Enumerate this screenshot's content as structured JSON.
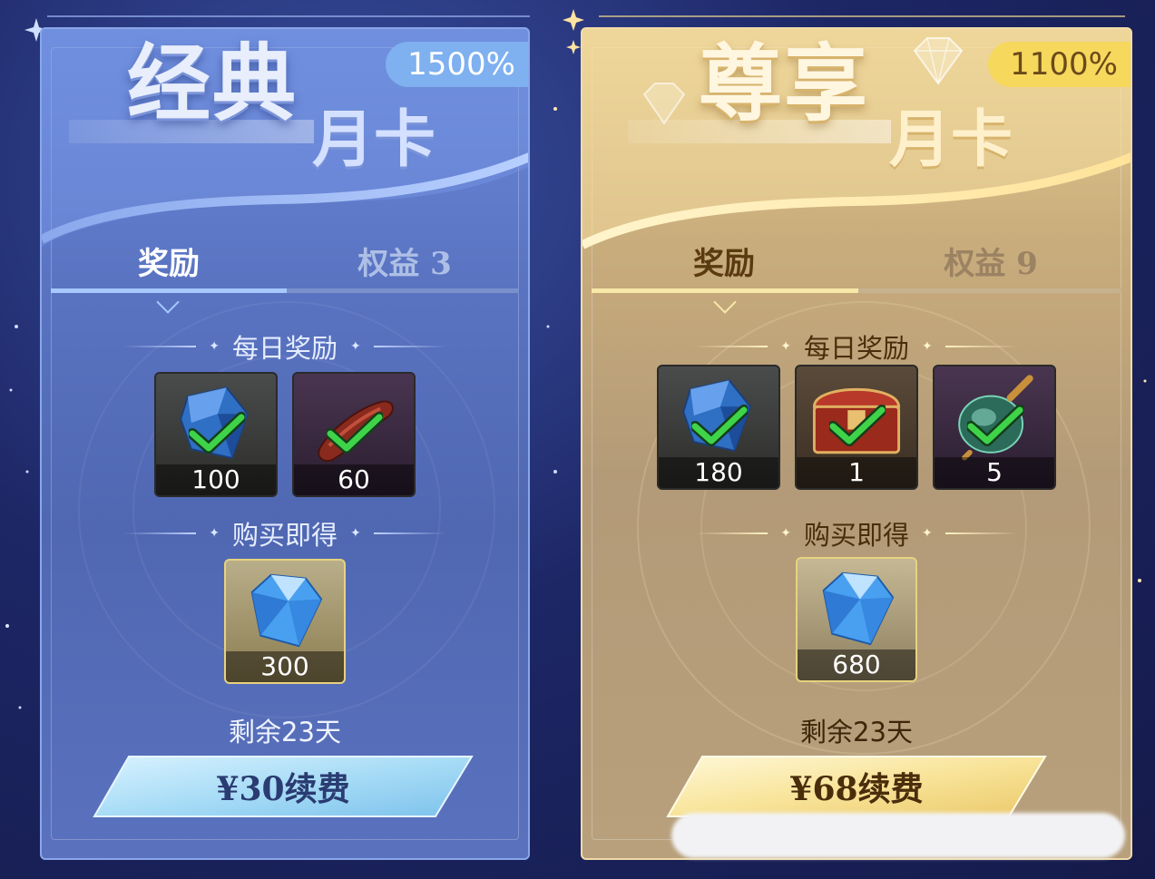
{
  "colors": {
    "classic_accent": "#6a8ad8",
    "premium_accent": "#e8cf94",
    "check_green": "#3fd34a",
    "background": "#1d2766"
  },
  "cards": [
    {
      "id": "classic",
      "title_main": "经典",
      "title_sub": "月卡",
      "badge": "1500%",
      "tabs": {
        "reward": "奖励",
        "benefits": "权益 3",
        "active": "reward"
      },
      "daily_title": "每日奖励",
      "daily_items": [
        {
          "icon": "blue-gem-icon",
          "qty": "100",
          "claimed": true
        },
        {
          "icon": "sausage-icon",
          "qty": "60",
          "claimed": true
        }
      ],
      "instant_title": "购买即得",
      "instant_items": [
        {
          "icon": "diamond-icon",
          "qty": "300"
        }
      ],
      "remaining": "剩余23天",
      "renew_label": "¥30续费"
    },
    {
      "id": "premium",
      "title_main": "尊享",
      "title_sub": "月卡",
      "badge": "1100%",
      "tabs": {
        "reward": "奖励",
        "benefits": "权益 9",
        "active": "reward"
      },
      "daily_title": "每日奖励",
      "daily_items": [
        {
          "icon": "blue-gem-icon",
          "qty": "180",
          "claimed": true
        },
        {
          "icon": "treasure-chest-icon",
          "qty": "1",
          "claimed": true
        },
        {
          "icon": "potion-bottle-icon",
          "qty": "5",
          "claimed": true
        }
      ],
      "instant_title": "购买即得",
      "instant_items": [
        {
          "icon": "diamond-icon",
          "qty": "680"
        }
      ],
      "remaining": "剩余23天",
      "renew_label": "¥68续费"
    }
  ]
}
